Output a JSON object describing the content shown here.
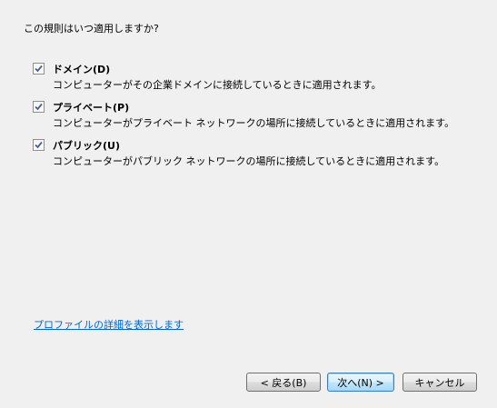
{
  "question": "この規則はいつ適用しますか?",
  "options": [
    {
      "title": "ドメイン(D)",
      "description": "コンピューターがその企業ドメインに接続しているときに適用されます。",
      "checked": true
    },
    {
      "title": "プライベート(P)",
      "description": "コンピューターがプライベート ネットワークの場所に接続しているときに適用されます。",
      "checked": true
    },
    {
      "title": "パブリック(U)",
      "description": "コンピューターがパブリック ネットワークの場所に接続しているときに適用されます。",
      "checked": true
    }
  ],
  "profile_link": "プロファイルの詳細を表示します",
  "buttons": {
    "back": "< 戻る(B)",
    "next": "次へ(N) >",
    "cancel": "キャンセル"
  },
  "colors": {
    "background": "#f0f0f0",
    "link": "#0066cc",
    "checkmark": "#4a5f97"
  }
}
